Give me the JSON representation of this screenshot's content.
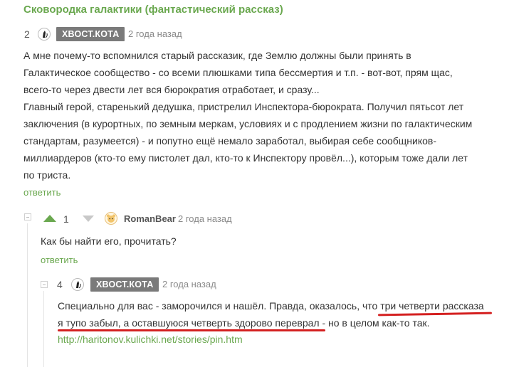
{
  "post": {
    "title": "Сковородка галактики (фантастический рассказ)"
  },
  "comments": [
    {
      "rating": "2",
      "author": "ХВОСТ.КОТА",
      "time": "2 года назад",
      "lines": [
        "А мне почему-то вспомнился старый рассказик, где Землю должны были принять в",
        "Галактическое сообщество - со всеми плюшками типа бессмертия и т.п. - вот-вот, прям щас,",
        "всего-то через двести лет вся бюрократия отработает, и сразу...",
        "Главный герой, старенький дедушка, пристрелил Инспектора-бюрократа. Получил пятьсот лет",
        "заключения (в курортных, по земным меркам, условиях и с продлением жизни по галактическим",
        "стандартам, разумеется) - и попутно ещё немало заработал, выбирая себе сообщников-",
        "миллиардеров (кто-то ему пистолет дал, кто-то к Инспектору провёл...), которым тоже дали лет",
        "по триста."
      ],
      "reply": "ответить"
    },
    {
      "rating": "1",
      "author": "RomanBear",
      "time": "2 года назад",
      "lines": [
        "Как бы найти его, прочитать?"
      ],
      "reply": "ответить"
    },
    {
      "rating": "4",
      "author": "ХВОСТ.КОТА",
      "time": "2 года назад",
      "lines": [
        "Специально для вас - заморочился и нашёл. Правда, оказалось, что три четверти рассказа",
        "я тупо забыл, а оставшуюся четверть здорово переврал - но в целом как-то так."
      ],
      "link": "http://haritonov.kulichki.net/stories/pin.htm"
    }
  ],
  "colors": {
    "accent": "#6aa84f",
    "badge": "#7a7a7a",
    "highlight_underline": "#d42020"
  }
}
